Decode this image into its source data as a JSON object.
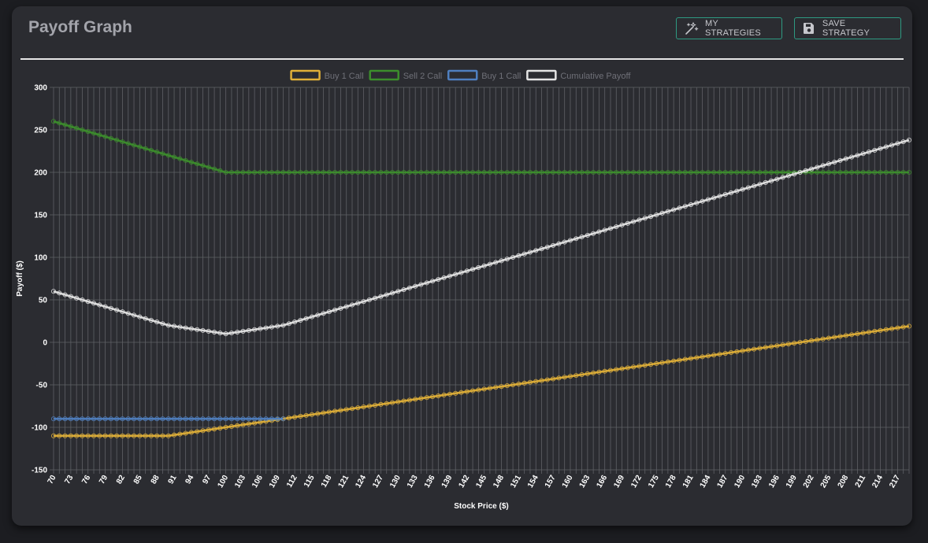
{
  "header": {
    "title": "Payoff Graph",
    "my_strategies_label": "MY STRATEGIES",
    "save_strategy_label": "SAVE STRATEGY",
    "my_strategies_icon": "magic-wand-icon",
    "save_strategy_icon": "floppy-disk-icon"
  },
  "colors": {
    "background": "#1c1d21",
    "card": "#2b2c31",
    "accent_border": "#2e9a82",
    "grid": "#5f6066"
  },
  "chart_data": {
    "type": "line",
    "xlabel": "Stock Price ($)",
    "ylabel": "Payoff ($)",
    "xlim": [
      70,
      219
    ],
    "ylim": [
      -150,
      300
    ],
    "y_ticks": [
      300,
      250,
      200,
      150,
      100,
      50,
      0,
      -50,
      -100,
      -150
    ],
    "x_tick_labels": [
      "70",
      "73",
      "76",
      "79",
      "82",
      "85",
      "88",
      "91",
      "94",
      "97",
      "100",
      "103",
      "106",
      "109",
      "112",
      "115",
      "118",
      "121",
      "124",
      "127",
      "130",
      "133",
      "136",
      "139",
      "142",
      "145",
      "148",
      "151",
      "154",
      "157",
      "160",
      "163",
      "166",
      "169",
      "172",
      "175",
      "178",
      "181",
      "184",
      "187",
      "190",
      "193",
      "196",
      "199",
      "202",
      "205",
      "208",
      "211",
      "214",
      "217"
    ],
    "grid": true,
    "legend_position": "top",
    "series": [
      {
        "name": "Buy 1 Call",
        "color": "#e0b038",
        "points": [
          [
            70,
            -110
          ],
          [
            90,
            -110
          ],
          [
            219,
            19
          ]
        ]
      },
      {
        "name": "Sell 2 Call",
        "color": "#3c8e2c",
        "points": [
          [
            70,
            260
          ],
          [
            100,
            200
          ],
          [
            219,
            200
          ]
        ]
      },
      {
        "name": "Buy 1 Call",
        "color": "#4f7fc0",
        "points": [
          [
            70,
            -90
          ],
          [
            110,
            -90
          ]
        ]
      },
      {
        "name": "Cumulative Payoff",
        "color": "#e4e4e4",
        "points": [
          [
            70,
            60
          ],
          [
            90,
            20
          ],
          [
            100,
            10
          ],
          [
            110,
            20
          ],
          [
            219,
            238
          ]
        ]
      }
    ]
  }
}
